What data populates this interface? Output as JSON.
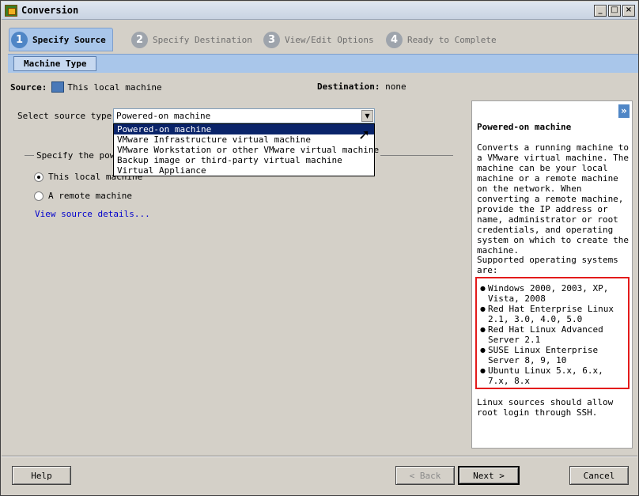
{
  "window": {
    "title": "Conversion",
    "minimize": "_",
    "maximize": "□",
    "close": "×"
  },
  "steps": [
    {
      "number": "1",
      "label": "Specify Source",
      "active": true
    },
    {
      "number": "2",
      "label": "Specify Destination",
      "active": false
    },
    {
      "number": "3",
      "label": "View/Edit Options",
      "active": false
    },
    {
      "number": "4",
      "label": "Ready to Complete",
      "active": false
    }
  ],
  "subtab": {
    "label": "Machine Type"
  },
  "source": {
    "label": "Source:",
    "value": "This local machine"
  },
  "destination": {
    "label": "Destination:",
    "value": "none"
  },
  "source_type": {
    "label": "Select source type:",
    "selected": "Powered-on machine",
    "options": [
      "Powered-on machine",
      "VMware Infrastructure virtual machine",
      "VMware Workstation or other VMware virtual machine",
      "Backup image or third-party virtual machine",
      "Virtual Appliance"
    ]
  },
  "group": {
    "label": "Specify the powe",
    "radios": [
      {
        "label": "This local machine",
        "checked": true
      },
      {
        "label": "A remote machine",
        "checked": false
      }
    ],
    "link": "View source details..."
  },
  "help": {
    "collapse": "»",
    "title": "Powered-on machine",
    "body": "Converts a running machine to a VMware virtual machine. The machine can be your local machine or a remote machine on the network. When converting a remote machine, provide the IP address or name, administrator or root credentials, and operating system on which to create the machine.",
    "os_label": "Supported operating systems are:",
    "os_list": [
      "Windows 2000, 2003, XP, Vista, 2008",
      "Red Hat Enterprise Linux 2.1, 3.0, 4.0, 5.0",
      "Red Hat Linux Advanced Server 2.1",
      "SUSE Linux Enterprise Server 8, 9, 10",
      "Ubuntu Linux 5.x, 6.x, 7.x, 8.x"
    ],
    "footer": "Linux sources should allow root login through SSH."
  },
  "buttons": {
    "help": "Help",
    "back": "< Back",
    "next": "Next >",
    "cancel": "Cancel"
  }
}
